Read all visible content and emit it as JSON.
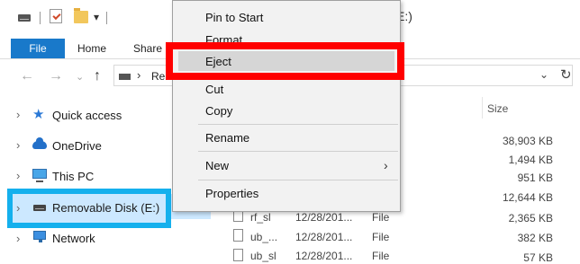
{
  "window": {
    "title_fragment": "E:)",
    "qat_dropdown": "▾"
  },
  "ribbon": {
    "tabs": [
      "File",
      "Home",
      "Share"
    ]
  },
  "address": {
    "text": "Re",
    "dropdown": "⌄",
    "refresh": "↻"
  },
  "nav_pane": {
    "items": [
      {
        "label": "Quick access",
        "icon": "star-icon"
      },
      {
        "label": "OneDrive",
        "icon": "cloud-icon"
      },
      {
        "label": "This PC",
        "icon": "computer-icon"
      },
      {
        "label": "Removable Disk (E:)",
        "icon": "drive-icon",
        "selected": true
      },
      {
        "label": "Network",
        "icon": "network-icon"
      }
    ]
  },
  "file_list": {
    "size_header": "Size",
    "sizes": [
      "38,903 KB",
      "1,494 KB",
      "951 KB",
      "12,644 KB",
      "2,365 KB",
      "382 KB",
      "57 KB"
    ],
    "visible_rows": [
      {
        "name": "rf_sl",
        "date": "12/28/201...",
        "type": "File"
      },
      {
        "name": "ub_...",
        "date": "12/28/201...",
        "type": "File"
      },
      {
        "name": "ub_sl",
        "date": "12/28/201...",
        "type": "File"
      }
    ]
  },
  "context_menu": {
    "items": [
      "Pin to Start",
      "Format",
      "Eject",
      "Cut",
      "Copy",
      "Rename",
      "New",
      "Properties"
    ],
    "highlighted": "Eject",
    "submenu_arrow": "›"
  },
  "colors": {
    "accent": "#1979ca",
    "selection": "#cce8ff",
    "selection_border": "#15b0ed",
    "highlight_box": "#ff0000",
    "menu_bg": "#f2f2f2"
  }
}
